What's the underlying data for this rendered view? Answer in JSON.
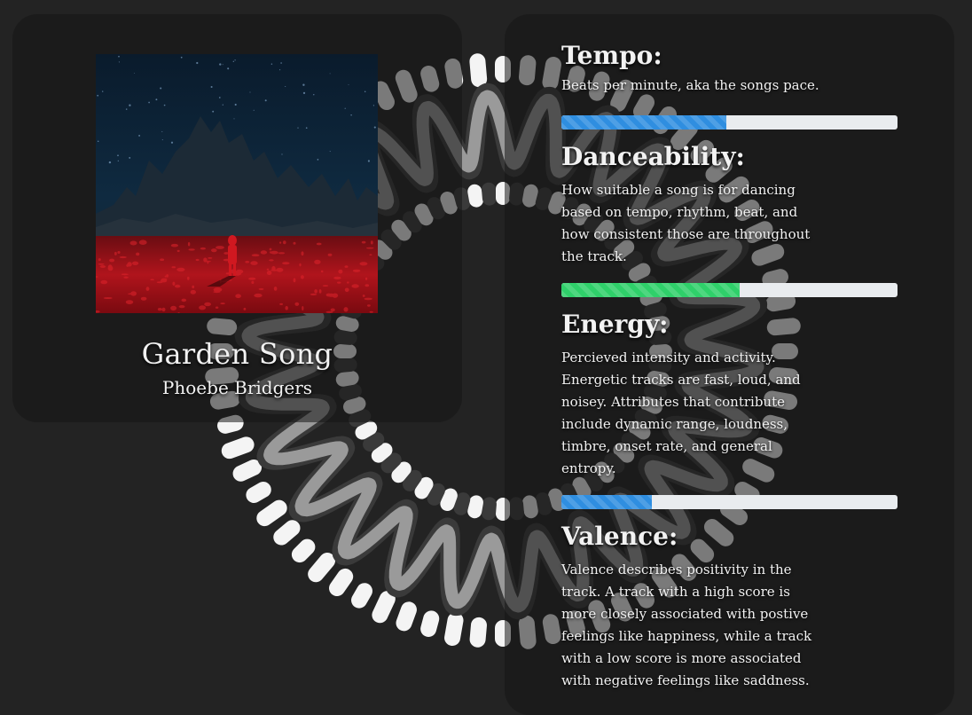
{
  "song": {
    "title": "Garden Song",
    "artist": "Phoebe Bridgers",
    "cover_icon": "album-cover-image"
  },
  "features": [
    {
      "title": "Tempo:",
      "description": "Beats per minute, aka the songs pace.",
      "value": 0.49,
      "color": "#2f8ee0"
    },
    {
      "title": "Danceability:",
      "description": "How suitable a song is for dancing based on tempo, rhythm, beat, and how consistent those are throughout the track.",
      "value": 0.53,
      "color": "#2fd06a"
    },
    {
      "title": "Energy:",
      "description": "Percieved intensity and activity. Energetic tracks are fast, loud, and noisey. Attributes that contribute include dynamic range, loudness, timbre, onset rate, and general entropy.",
      "value": 0.27,
      "color": "#2f8ee0"
    },
    {
      "title": "Valence:",
      "description": "Valence describes positivity in the track. A track with a high score is more closely associated with postive feelings like happiness, while a track with a low score is more associated with negative feelings like saddness."
    }
  ],
  "visualizer": {
    "colors": [
      "#f4f4f4",
      "#ababab",
      "#3a3a3a"
    ]
  }
}
